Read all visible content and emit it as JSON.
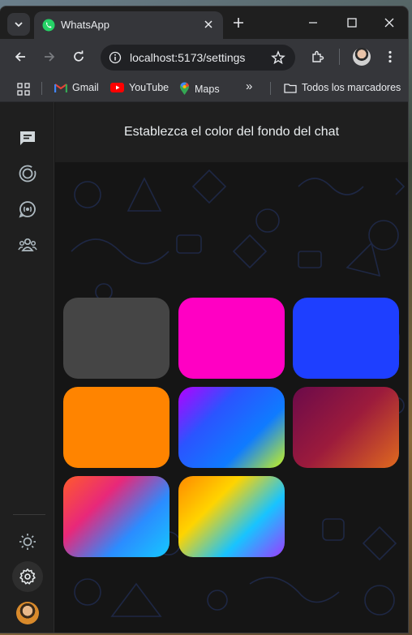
{
  "browser": {
    "tab_title": "WhatsApp",
    "url": "localhost:5173/settings",
    "bookmarks": [
      {
        "label": "Gmail",
        "icon": "gmail-icon"
      },
      {
        "label": "YouTube",
        "icon": "youtube-icon"
      },
      {
        "label": "Maps",
        "icon": "maps-icon"
      }
    ],
    "all_bookmarks_label": "Todos los marcadores"
  },
  "sidebar": {
    "items": [
      {
        "icon": "chats-icon"
      },
      {
        "icon": "status-icon"
      },
      {
        "icon": "channels-icon"
      },
      {
        "icon": "communities-icon"
      }
    ],
    "bottom": [
      {
        "icon": "theme-toggle-icon"
      },
      {
        "icon": "settings-icon"
      },
      {
        "icon": "profile-avatar"
      }
    ]
  },
  "settings": {
    "title": "Establezca el color del fondo del chat",
    "swatches": [
      {
        "name": "gray",
        "color": "#454545"
      },
      {
        "name": "magenta",
        "color": "#ff00c3"
      },
      {
        "name": "blue",
        "color": "#1e3fff"
      },
      {
        "name": "orange",
        "color": "#ff8400"
      },
      {
        "name": "purple-blue-lime",
        "gradient": [
          "#b400ff",
          "#2b54ff",
          "#0f7bff",
          "#c6f31f"
        ]
      },
      {
        "name": "maroon-orange",
        "gradient": [
          "#6b0a4a",
          "#9c1b3c",
          "#e06a1e"
        ]
      },
      {
        "name": "red-pink-blue",
        "gradient": [
          "#ff5a2b",
          "#e8287a",
          "#2b8cff",
          "#15c8ff"
        ]
      },
      {
        "name": "yellow-blue-purple",
        "gradient": [
          "#ff8a00",
          "#ffd400",
          "#18c4ff",
          "#9b3cff"
        ]
      }
    ]
  }
}
